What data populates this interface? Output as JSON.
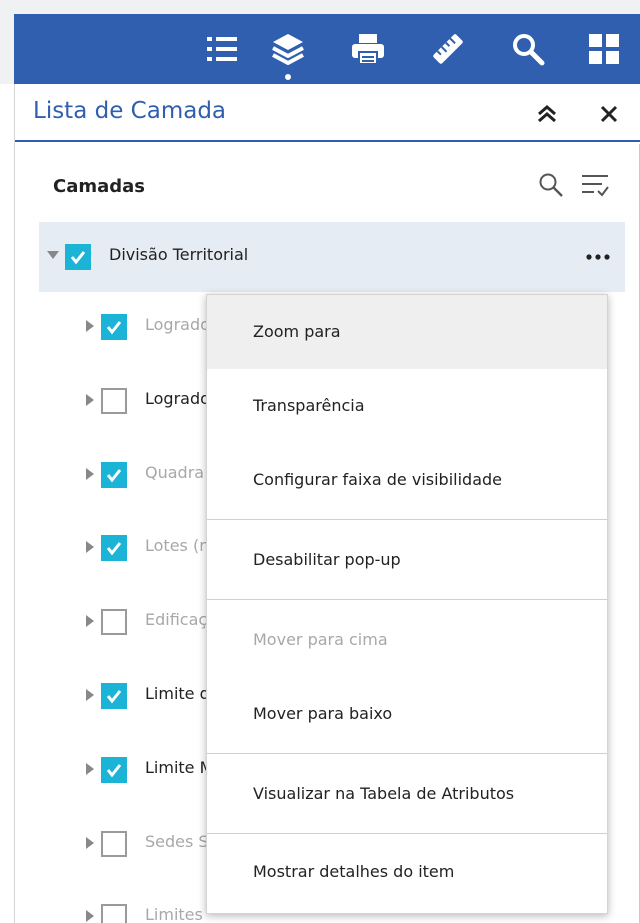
{
  "toolbar": {
    "items": [
      {
        "icon": "layer-list-icon"
      },
      {
        "icon": "layers-icon",
        "active": true
      },
      {
        "icon": "print-icon"
      },
      {
        "icon": "measure-ruler-icon"
      },
      {
        "icon": "search-icon"
      },
      {
        "icon": "grid-apps-icon"
      }
    ],
    "color": "#2f5fae"
  },
  "panel": {
    "title": "Lista de Camada",
    "collapse_icon": "double-chevron-up-icon",
    "close_icon": "close-icon"
  },
  "layers": {
    "title": "Camadas",
    "group": {
      "label": "Divisão Territorial",
      "checked": true,
      "expanded": true
    },
    "items": [
      {
        "label": "Logrado",
        "checked": true,
        "dim": true
      },
      {
        "label": "Logrado",
        "checked": false,
        "dim": false
      },
      {
        "label": "Quadra",
        "checked": true,
        "dim": true
      },
      {
        "label": "Lotes (n",
        "checked": true,
        "dim": true
      },
      {
        "label": "Edificaç",
        "checked": false,
        "dim": true
      },
      {
        "label": "Limite d",
        "checked": true,
        "dim": false
      },
      {
        "label": "Limite M",
        "checked": true,
        "dim": false
      },
      {
        "label": "Sedes S",
        "checked": false,
        "dim": true
      },
      {
        "label": "Limites",
        "checked": false,
        "dim": true
      }
    ]
  },
  "menu": {
    "items": [
      {
        "label": "Zoom para",
        "disabled": false,
        "hover": true
      },
      {
        "label": "Transparência",
        "disabled": false
      },
      {
        "label": "Configurar faixa de visibilidade",
        "disabled": false
      },
      {
        "label": "Desabilitar pop-up",
        "disabled": false
      },
      {
        "label": "Mover para cima",
        "disabled": true
      },
      {
        "label": "Mover para baixo",
        "disabled": false
      },
      {
        "label": "Visualizar na Tabela de Atributos",
        "disabled": false
      },
      {
        "label": "Mostrar detalhes do item",
        "disabled": false
      }
    ]
  },
  "colors": {
    "accent": "#2f5fae",
    "checkbox": "#1bb3d6",
    "group_row": "#e6ecf3"
  }
}
